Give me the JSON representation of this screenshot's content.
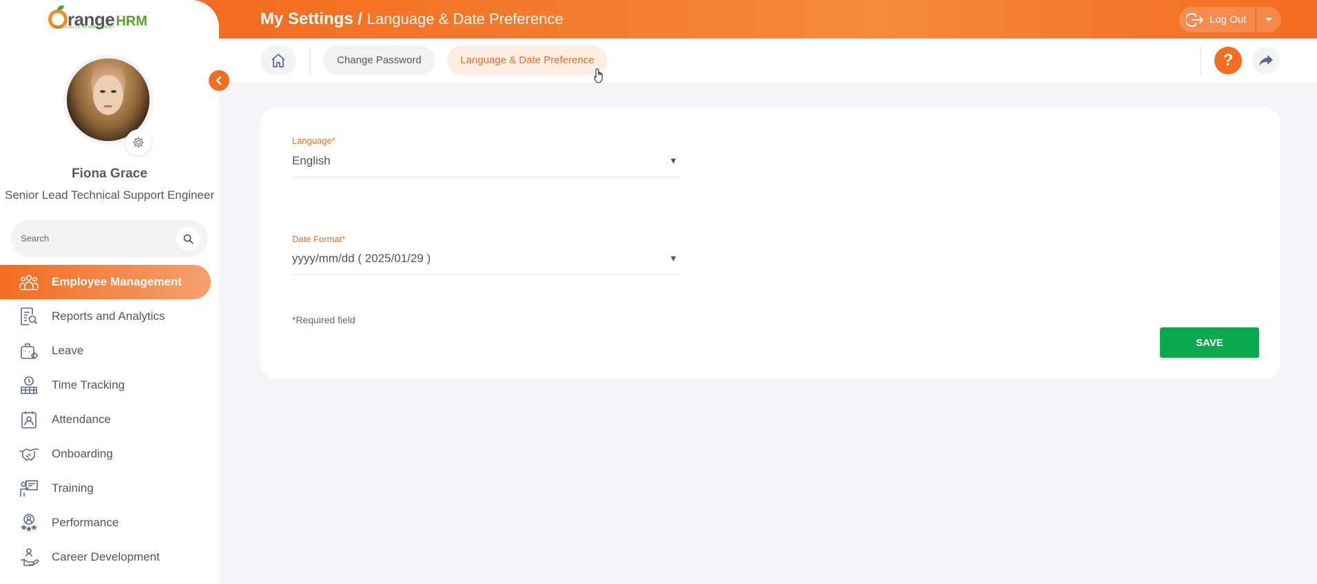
{
  "brand": {
    "logo_main": "range",
    "logo_hrm": "HRM",
    "tagline": "NEW LEVEL OF HR MANAGEMENT"
  },
  "user": {
    "name": "Fiona Grace",
    "title": "Senior Lead Technical Support Engineer"
  },
  "search": {
    "placeholder": "Search"
  },
  "sidebar": {
    "items": [
      {
        "label": "Employee Management",
        "icon": "employees-icon",
        "active": true
      },
      {
        "label": "Reports and Analytics",
        "icon": "reports-icon"
      },
      {
        "label": "Leave",
        "icon": "leave-icon"
      },
      {
        "label": "Time Tracking",
        "icon": "time-tracking-icon"
      },
      {
        "label": "Attendance",
        "icon": "attendance-icon"
      },
      {
        "label": "Onboarding",
        "icon": "onboarding-icon"
      },
      {
        "label": "Training",
        "icon": "training-icon"
      },
      {
        "label": "Performance",
        "icon": "performance-icon"
      },
      {
        "label": "Career Development",
        "icon": "career-development-icon"
      }
    ]
  },
  "header": {
    "title_main": "My Settings /",
    "title_sub": "Language & Date Preference",
    "logout_label": "Log Out"
  },
  "tabs": {
    "change_password": "Change Password",
    "language_date": "Language & Date Preference"
  },
  "help": {
    "label": "?"
  },
  "form": {
    "language": {
      "label": "Language",
      "required_mark": "*",
      "value": "English"
    },
    "date_format": {
      "label": "Date Format",
      "required_mark": "*",
      "value": "yyyy/mm/dd ( 2025/01/29 )"
    },
    "required_note": "*Required field",
    "save_label": "SAVE"
  },
  "colors": {
    "accent": "#f36c21",
    "save": "#0aa84f",
    "background": "#f4f5f8"
  }
}
